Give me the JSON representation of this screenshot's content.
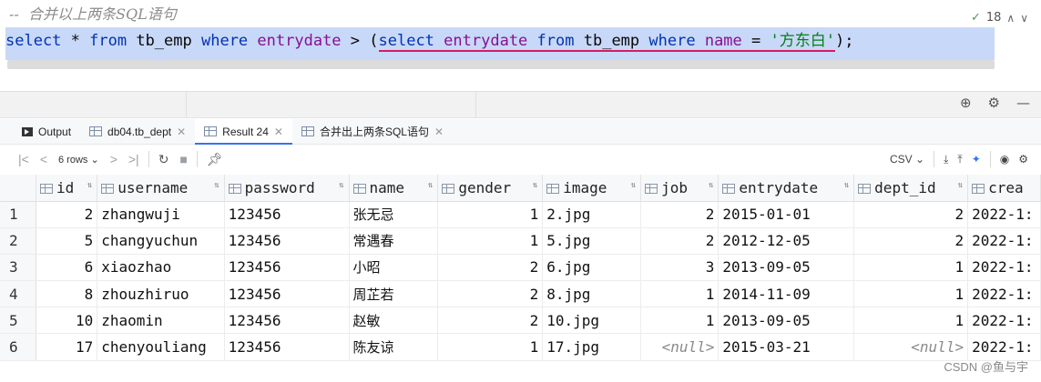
{
  "editor": {
    "comment": "--  合并以上两条SQL语句",
    "sql": {
      "t1": "select",
      "t2": " * ",
      "t3": "from",
      "t4": " tb_emp ",
      "t5": "where",
      "t6": " ",
      "t7": "entrydate",
      "t8": " > (",
      "t9": "select",
      "t10": " ",
      "t11": "entrydate",
      "t12": " ",
      "t13": "from",
      "t14": " tb_emp ",
      "t15": "where",
      "t16": " ",
      "t17": "name",
      "t18": " = ",
      "t19": "'方东白'",
      "t20": ");"
    },
    "inspection_count": "18"
  },
  "tabs": [
    {
      "label": "Output",
      "icon": "output-icon"
    },
    {
      "label": "db04.tb_dept",
      "icon": "table-icon"
    },
    {
      "label": "Result 24",
      "icon": "table-icon",
      "active": true
    },
    {
      "label": "合并出上两条SQL语句",
      "icon": "table-icon"
    }
  ],
  "toolbar": {
    "rows": "6 rows",
    "export_format": "CSV"
  },
  "table": {
    "columns": [
      "id",
      "username",
      "password",
      "name",
      "gender",
      "image",
      "job",
      "entrydate",
      "dept_id",
      "crea"
    ],
    "rows": [
      {
        "n": "1",
        "id": "2",
        "username": "zhangwuji",
        "password": "123456",
        "name": "张无忌",
        "gender": "1",
        "image": "2.jpg",
        "job": "2",
        "entrydate": "2015-01-01",
        "dept_id": "2",
        "crea": "2022-1:"
      },
      {
        "n": "2",
        "id": "5",
        "username": "changyuchun",
        "password": "123456",
        "name": "常遇春",
        "gender": "1",
        "image": "5.jpg",
        "job": "2",
        "entrydate": "2012-12-05",
        "dept_id": "2",
        "crea": "2022-1:"
      },
      {
        "n": "3",
        "id": "6",
        "username": "xiaozhao",
        "password": "123456",
        "name": "小昭",
        "gender": "2",
        "image": "6.jpg",
        "job": "3",
        "entrydate": "2013-09-05",
        "dept_id": "1",
        "crea": "2022-1:"
      },
      {
        "n": "4",
        "id": "8",
        "username": "zhouzhiruo",
        "password": "123456",
        "name": "周芷若",
        "gender": "2",
        "image": "8.jpg",
        "job": "1",
        "entrydate": "2014-11-09",
        "dept_id": "1",
        "crea": "2022-1:"
      },
      {
        "n": "5",
        "id": "10",
        "username": "zhaomin",
        "password": "123456",
        "name": "赵敏",
        "gender": "2",
        "image": "10.jpg",
        "job": "1",
        "entrydate": "2013-09-05",
        "dept_id": "1",
        "crea": "2022-1:"
      },
      {
        "n": "6",
        "id": "17",
        "username": "chenyouliang",
        "password": "123456",
        "name": "陈友谅",
        "gender": "1",
        "image": "17.jpg",
        "job": "<null>",
        "entrydate": "2015-03-21",
        "dept_id": "<null>",
        "crea": "2022-1:"
      }
    ]
  },
  "watermark": "CSDN @鱼与宇"
}
